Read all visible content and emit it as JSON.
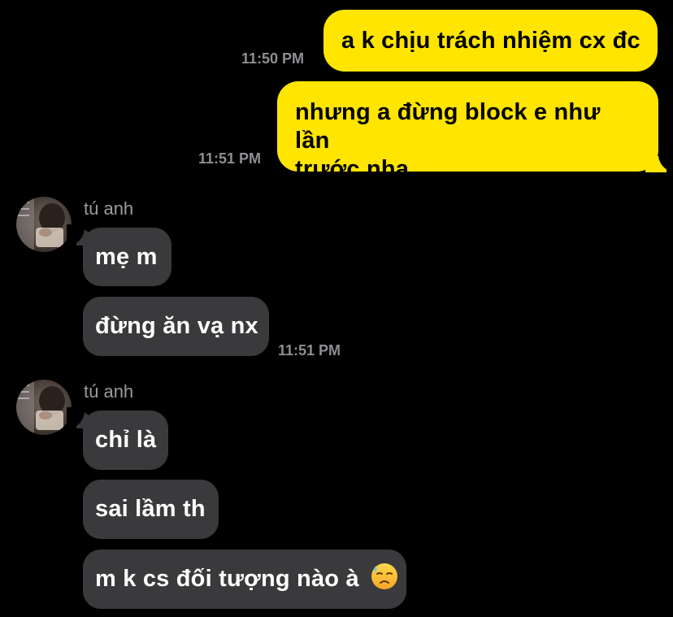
{
  "messages": {
    "out1": {
      "text": "a k chịu trách nhiệm cx đc",
      "time": "11:50 PM"
    },
    "out2": {
      "line1": "nhưng a đừng block e như lần",
      "line2": "trước nha",
      "time": "11:51 PM"
    },
    "group1": {
      "sender": "tú anh",
      "msg1": "mẹ m",
      "msg2": "đừng ăn vạ nx",
      "time": "11:51 PM"
    },
    "group2": {
      "sender": "tú anh",
      "msg1": "chỉ là",
      "msg2": "sai lầm th",
      "msg3": "m k cs đối tượng nào à",
      "emoji": "downcast-face-with-sweat"
    }
  },
  "colors": {
    "background": "#000000",
    "outgoing_bubble": "#ffe500",
    "incoming_bubble": "#3a3a3c",
    "timestamp": "#8e8e93",
    "sender_name": "#9a9a9f"
  },
  "icons": {
    "avatar": "user-avatar-photo",
    "emoji": "downcast-face-with-sweat-emoji"
  }
}
